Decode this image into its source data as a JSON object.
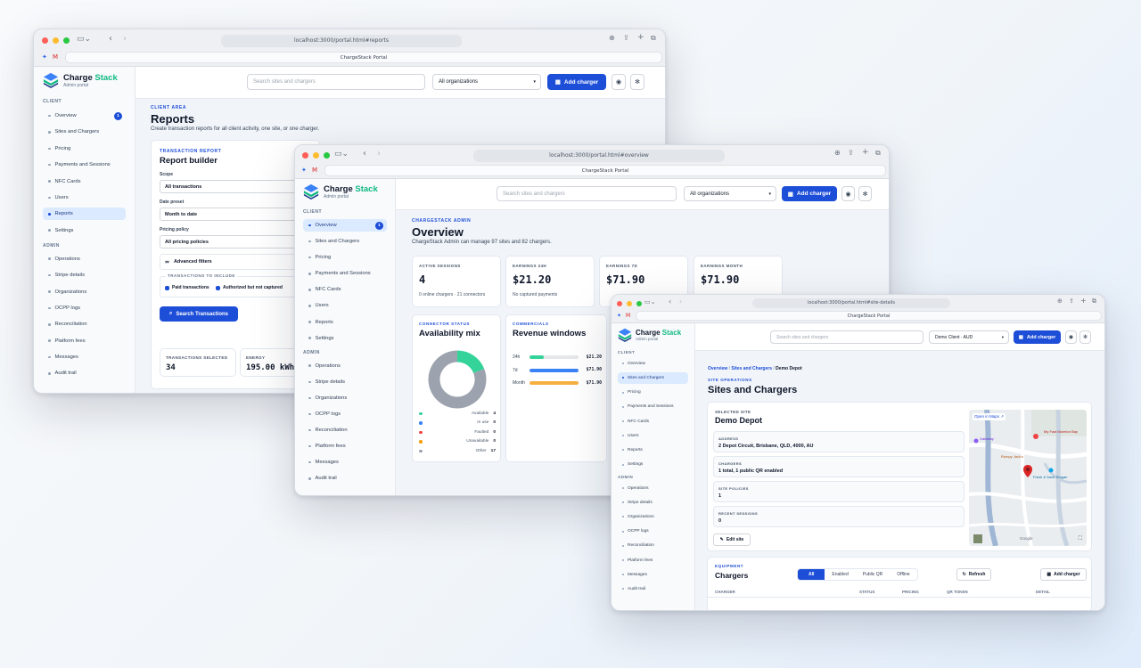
{
  "brand": {
    "name_a": "Charge",
    "name_b": "Stack",
    "subtitle": "Admin portal"
  },
  "colors": {
    "primary": "#1d4ed8",
    "accent": "#10b981",
    "available": "#34d399",
    "in_use": "#3b82f6",
    "faulted": "#ef4444",
    "unavailable": "#f59e0b",
    "other": "#9ca3af"
  },
  "nav": {
    "client_label": "CLIENT",
    "admin_label": "ADMIN",
    "client_items": [
      "Overview",
      "Sites and Chargers",
      "Pricing",
      "Payments and Sessions",
      "NFC Cards",
      "Users",
      "Reports",
      "Settings"
    ],
    "admin_items": [
      "Operations",
      "Stripe details",
      "Organizations",
      "OCPP logs",
      "Reconciliation",
      "Platform fees",
      "Messages",
      "Audit trail"
    ],
    "overview_badge": "1"
  },
  "top": {
    "search_placeholder": "Search sites and chargers",
    "org_select": "All organizations",
    "add_charger": "Add charger"
  },
  "w1": {
    "url": "localhost:3000/portal.html#reports",
    "tab": "ChargeStack Portal",
    "eyebrow": "CLIENT AREA",
    "title": "Reports",
    "desc": "Create transaction reports for all client activity, one site, or one charger.",
    "card_eyebrow": "TRANSACTION REPORT",
    "card_title": "Report builder",
    "scope_label": "Scope",
    "scope_value": "All transactions",
    "date_label": "Date preset",
    "date_value": "Month to date",
    "pricing_label": "Pricing policy",
    "pricing_value": "All pricing policies",
    "advanced": "Advanced filters",
    "include_label": "TRANSACTIONS TO INCLUDE",
    "chk1": "Paid transactions",
    "chk2": "Authorized but not captured",
    "search_btn": "Search Transactions",
    "stat1_label": "TRANSACTIONS SELECTED",
    "stat1_value": "34",
    "stat2_label": "ENERGY",
    "stat2_value": "195.00 kWh"
  },
  "w2": {
    "url": "localhost:3000/portal.html#overview",
    "tab": "ChargeStack Portal",
    "eyebrow": "CHARGESTACK ADMIN",
    "title": "Overview",
    "desc": "ChargeStack Admin can manage 97 sites and 82 chargers.",
    "kpis": [
      {
        "label": "ACTIVE SESSIONS",
        "value": "4",
        "note": "0 online chargers · 21 connectors"
      },
      {
        "label": "EARNINGS 24H",
        "value": "$21.20",
        "note": "No captured payments"
      },
      {
        "label": "EARNINGS 7D",
        "value": "$71.90",
        "note": ""
      },
      {
        "label": "EARNINGS MONTH",
        "value": "$71.90",
        "note": ""
      }
    ],
    "conn_eyebrow": "CONNECTOR STATUS",
    "conn_title": "Availability mix",
    "legend": [
      {
        "name": "Available",
        "value": 4,
        "color": "#34d399"
      },
      {
        "name": "In use",
        "value": 0,
        "color": "#3b82f6"
      },
      {
        "name": "Faulted",
        "value": 0,
        "color": "#ef4444"
      },
      {
        "name": "Unavailable",
        "value": 0,
        "color": "#f59e0b"
      },
      {
        "name": "Other",
        "value": 17,
        "color": "#9ca3af"
      }
    ],
    "comm_eyebrow": "COMMERCIALS",
    "comm_title": "Revenue windows",
    "revenue": [
      {
        "label": "24h",
        "value": "$21.20",
        "fraction": 0.29,
        "color": "#34d399"
      },
      {
        "label": "7d",
        "value": "$71.90",
        "fraction": 1.0,
        "color": "#3b82f6"
      },
      {
        "label": "Month",
        "value": "$71.90",
        "fraction": 1.0,
        "color": "#f5b041"
      }
    ]
  },
  "w3": {
    "url": "localhost:3000/portal.html#site-details",
    "tab": "ChargeStack Portal",
    "org_select": "Demo Client · AUD",
    "crumb1": "Overview",
    "crumb2": "Sites and Chargers",
    "crumb3": "Demo Depot",
    "eyebrow": "SITE OPERATIONS",
    "title": "Sites and Chargers",
    "sel_label": "SELECTED SITE",
    "site_name": "Demo Depot",
    "addr_label": "ADDRESS",
    "addr_value": "2 Depot Circuit, Brisbane, QLD, 4000, AU",
    "chg_label": "CHARGERS",
    "chg_value": "1 total, 1 public QR enabled",
    "pol_label": "SITE POLICIES",
    "pol_value": "1",
    "rec_label": "RECENT SESSIONS",
    "rec_value": "0",
    "edit_btn": "Edit site",
    "map_link": "Open in Maps",
    "map_labels": {
      "a": "Gateway",
      "b": "My Fast Moreton Bay",
      "c": "Rumpy Jack's",
      "d": "Fresh & Save Teagan",
      "e": "Google"
    },
    "eq_eyebrow": "EQUIPMENT",
    "eq_title": "Chargers",
    "filters": [
      "All",
      "Enabled",
      "Public QR",
      "Offline"
    ],
    "refresh": "Refresh",
    "add_charger": "Add charger",
    "cols": [
      "CHARGER",
      "STATUS",
      "PRICING",
      "QR TOKEN",
      "DETAIL"
    ]
  }
}
